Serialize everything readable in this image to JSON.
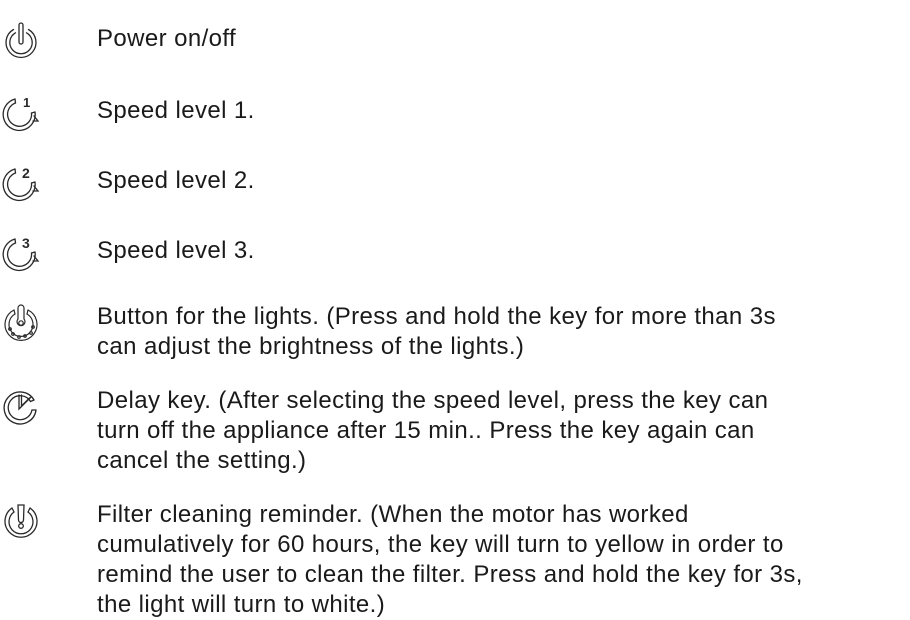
{
  "items": [
    {
      "icon": "power-icon",
      "text": "Power on/off"
    },
    {
      "icon": "speed-1-icon",
      "text": "Speed level 1."
    },
    {
      "icon": "speed-2-icon",
      "text": "Speed level 2."
    },
    {
      "icon": "speed-3-icon",
      "text": "Speed level 3."
    },
    {
      "icon": "light-bulb-icon",
      "text": "Button for the lights. (Press and hold the key for more than 3s\ncan adjust the brightness of the lights.)"
    },
    {
      "icon": "timer-icon",
      "text": "Delay key. (After selecting the speed level, press the key can\nturn off the appliance after 15 min.. Press the key again can\ncancel the setting.)"
    },
    {
      "icon": "filter-icon",
      "text": "Filter cleaning reminder. (When the motor has worked\ncumulatively for 60 hours, the key will turn to yellow in order to\nremind the user to clean the filter. Press and hold the key for 3s,\nthe light will turn to white.)"
    }
  ],
  "speed_digits": [
    "1",
    "2",
    "3"
  ],
  "colors": {
    "stroke": "#2a2a2a",
    "text": "#1a1a1a"
  }
}
